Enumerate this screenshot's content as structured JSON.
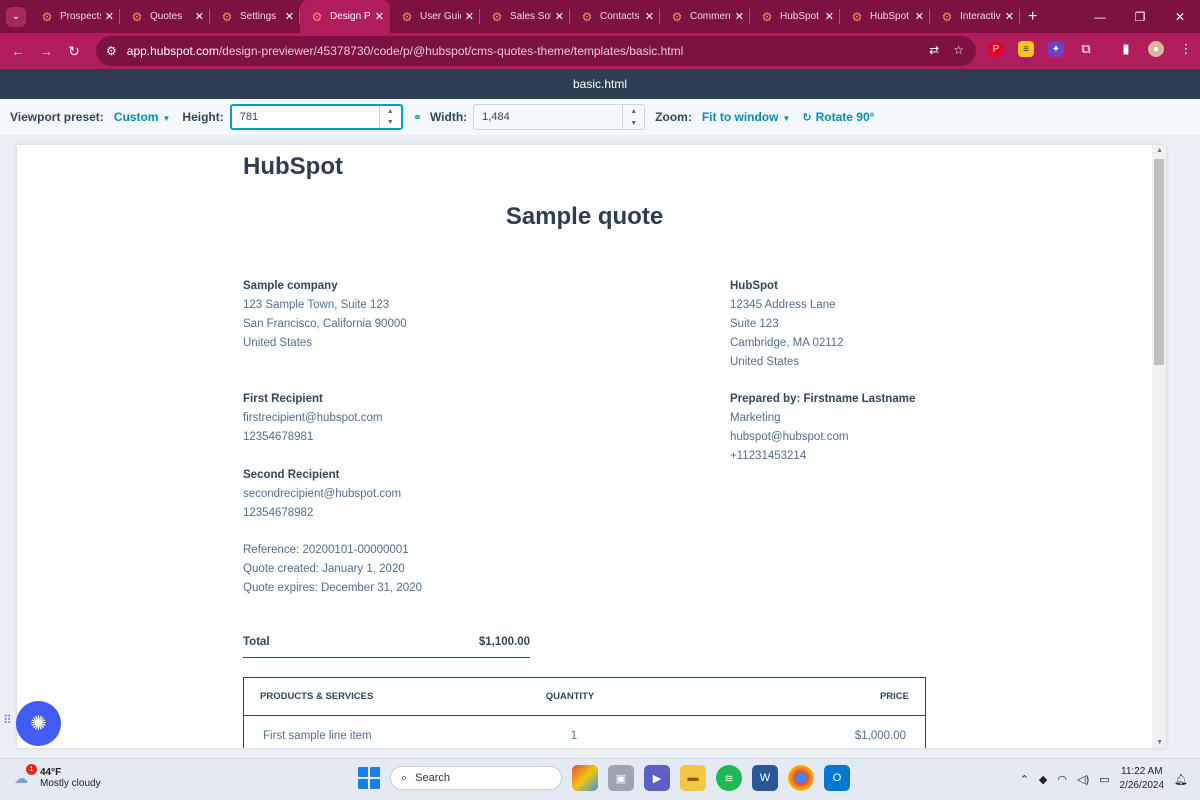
{
  "browser": {
    "tabs": [
      {
        "title": "Prospects",
        "active": false
      },
      {
        "title": "Quotes",
        "active": false
      },
      {
        "title": "Settings",
        "active": false
      },
      {
        "title": "Design Previewer",
        "active": true
      },
      {
        "title": "User Guide",
        "active": false
      },
      {
        "title": "Sales Software",
        "active": false
      },
      {
        "title": "Contacts",
        "active": false
      },
      {
        "title": "Comments",
        "active": false
      },
      {
        "title": "HubSpot",
        "active": false
      },
      {
        "title": "HubSpot",
        "active": false
      },
      {
        "title": "Interactive",
        "active": false
      }
    ],
    "url_host": "app.hubspot.com",
    "url_path": "/design-previewer/45378730/code/p/@hubspot/cms-quotes-theme/templates/basic.html",
    "colors": {
      "frame": "#7d1242",
      "toolbar": "#b01c5c"
    }
  },
  "previewer": {
    "file_name": "basic.html",
    "viewport_label": "Viewport preset:",
    "viewport_value": "Custom",
    "height_label": "Height:",
    "height_value": "781",
    "width_label": "Width:",
    "width_value": "1,484",
    "zoom_label": "Zoom:",
    "zoom_value": "Fit to window",
    "rotate_label": "Rotate 90°"
  },
  "quote": {
    "brand": "HubSpot",
    "title": "Sample quote",
    "company": {
      "name": "Sample company",
      "lines": [
        "123 Sample Town, Suite 123",
        "San Francisco, California 90000",
        "United States"
      ]
    },
    "sender": {
      "name": "HubSpot",
      "lines": [
        "12345 Address Lane",
        "Suite 123",
        "Cambridge, MA 02112",
        "United States"
      ]
    },
    "recipient1": {
      "name": "First Recipient",
      "email": "firstrecipient@hubspot.com",
      "phone": "12354678981"
    },
    "recipient2": {
      "name": "Second Recipient",
      "email": "secondrecipient@hubspot.com",
      "phone": "12354678982"
    },
    "prepared": {
      "name": "Prepared by: Firstname Lastname",
      "dept": "Marketing",
      "email": "hubspot@hubspot.com",
      "phone": "+11231453214"
    },
    "meta": [
      "Reference: 20200101-00000001",
      "Quote created: January 1, 2020",
      "Quote expires: December 31, 2020"
    ],
    "total_label": "Total",
    "total_value": "$1,100.00",
    "table": {
      "headers": [
        "PRODUCTS & SERVICES",
        "QUANTITY",
        "PRICE"
      ],
      "rows": [
        {
          "name": "First sample line item",
          "qty": "1",
          "price": "$1,000.00"
        }
      ]
    }
  },
  "taskbar": {
    "weather_temp": "44°F",
    "weather_desc": "Mostly cloudy",
    "weather_badge": "1",
    "search_label": "Search",
    "time": "11:22 AM",
    "date": "2/26/2024"
  }
}
